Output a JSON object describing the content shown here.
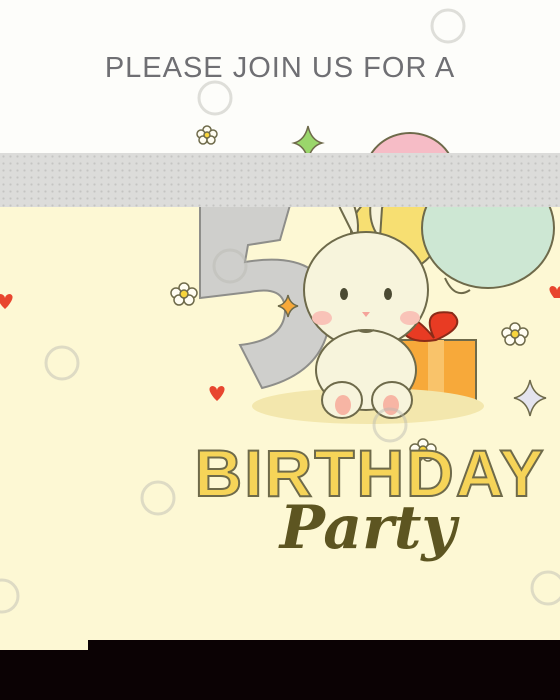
{
  "invite": {
    "heading": "PLEASE JOIN US FOR A",
    "title_line1": "BIRTHDAY",
    "title_line2": "Party"
  },
  "icons": [
    "rabbit-icon",
    "balloon-icon",
    "gift-box-icon",
    "daisy-icon",
    "heart-icon",
    "sparkle-icon",
    "watermark-icon"
  ],
  "colors": {
    "paper_top": "#fdfdfa",
    "paper_body": "#fdf8d4",
    "title_yellow": "#f6d458",
    "party_brown": "#5d5521",
    "balloon_mint": "#cde7d3",
    "balloon_yellow": "#f7df72",
    "balloon_pink": "#f6bcc6",
    "gift_orange": "#f7a93a",
    "ribbon_red": "#e83b23",
    "bottom_bar": "#0b0204"
  }
}
